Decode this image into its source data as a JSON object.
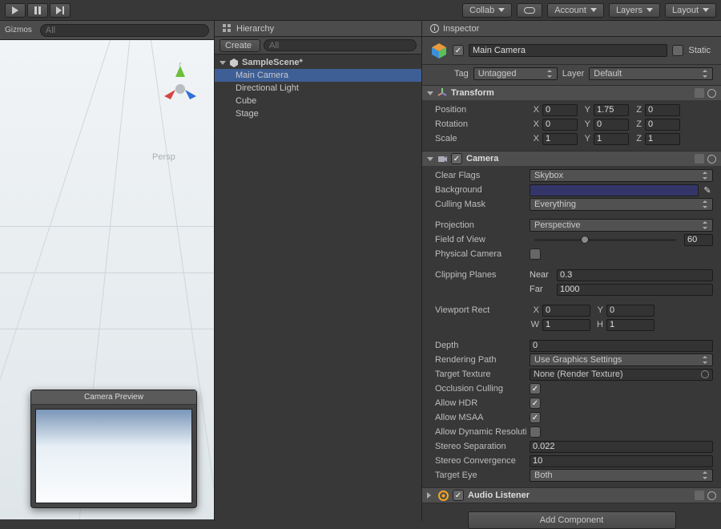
{
  "topbar": {
    "collab": "Collab",
    "account": "Account",
    "layers": "Layers",
    "layout": "Layout"
  },
  "scene": {
    "gizmos": "Gizmos",
    "search_placeholder": "All",
    "persp": "Persp",
    "cam_preview_title": "Camera Preview"
  },
  "hierarchy": {
    "tab": "Hierarchy",
    "create": "Create",
    "search_placeholder": "All",
    "scene": "SampleScene*",
    "items": [
      "Main Camera",
      "Directional Light",
      "Cube",
      "Stage"
    ]
  },
  "inspector": {
    "tab": "Inspector",
    "obj_name": "Main Camera",
    "static_label": "Static",
    "tag_label": "Tag",
    "tag_value": "Untagged",
    "layer_label": "Layer",
    "layer_value": "Default",
    "transform": {
      "title": "Transform",
      "position_label": "Position",
      "rotation_label": "Rotation",
      "scale_label": "Scale",
      "pos": {
        "x": "0",
        "y": "1.75",
        "z": "0"
      },
      "rot": {
        "x": "0",
        "y": "0",
        "z": "0"
      },
      "scl": {
        "x": "1",
        "y": "1",
        "z": "1"
      }
    },
    "camera": {
      "title": "Camera",
      "clear_flags_label": "Clear Flags",
      "clear_flags": "Skybox",
      "background_label": "Background",
      "culling_label": "Culling Mask",
      "culling": "Everything",
      "projection_label": "Projection",
      "projection": "Perspective",
      "fov_label": "Field of View",
      "fov": "60",
      "physical_label": "Physical Camera",
      "clip_label": "Clipping Planes",
      "near_label": "Near",
      "near": "0.3",
      "far_label": "Far",
      "far": "1000",
      "viewport_label": "Viewport Rect",
      "vx": "0",
      "vy": "0",
      "vw": "1",
      "vh": "1",
      "depth_label": "Depth",
      "depth": "0",
      "rendpath_label": "Rendering Path",
      "rendpath": "Use Graphics Settings",
      "target_tex_label": "Target Texture",
      "target_tex": "None (Render Texture)",
      "occlusion_label": "Occlusion Culling",
      "hdr_label": "Allow HDR",
      "msaa_label": "Allow MSAA",
      "dynres_label": "Allow Dynamic Resolution",
      "stereo_sep_label": "Stereo Separation",
      "stereo_sep": "0.022",
      "stereo_conv_label": "Stereo Convergence",
      "stereo_conv": "10",
      "target_eye_label": "Target Eye",
      "target_eye": "Both"
    },
    "audio": {
      "title": "Audio Listener"
    },
    "add_component": "Add Component"
  },
  "axis": {
    "x": "X",
    "y": "Y",
    "z": "Z",
    "w": "W",
    "h": "H"
  }
}
